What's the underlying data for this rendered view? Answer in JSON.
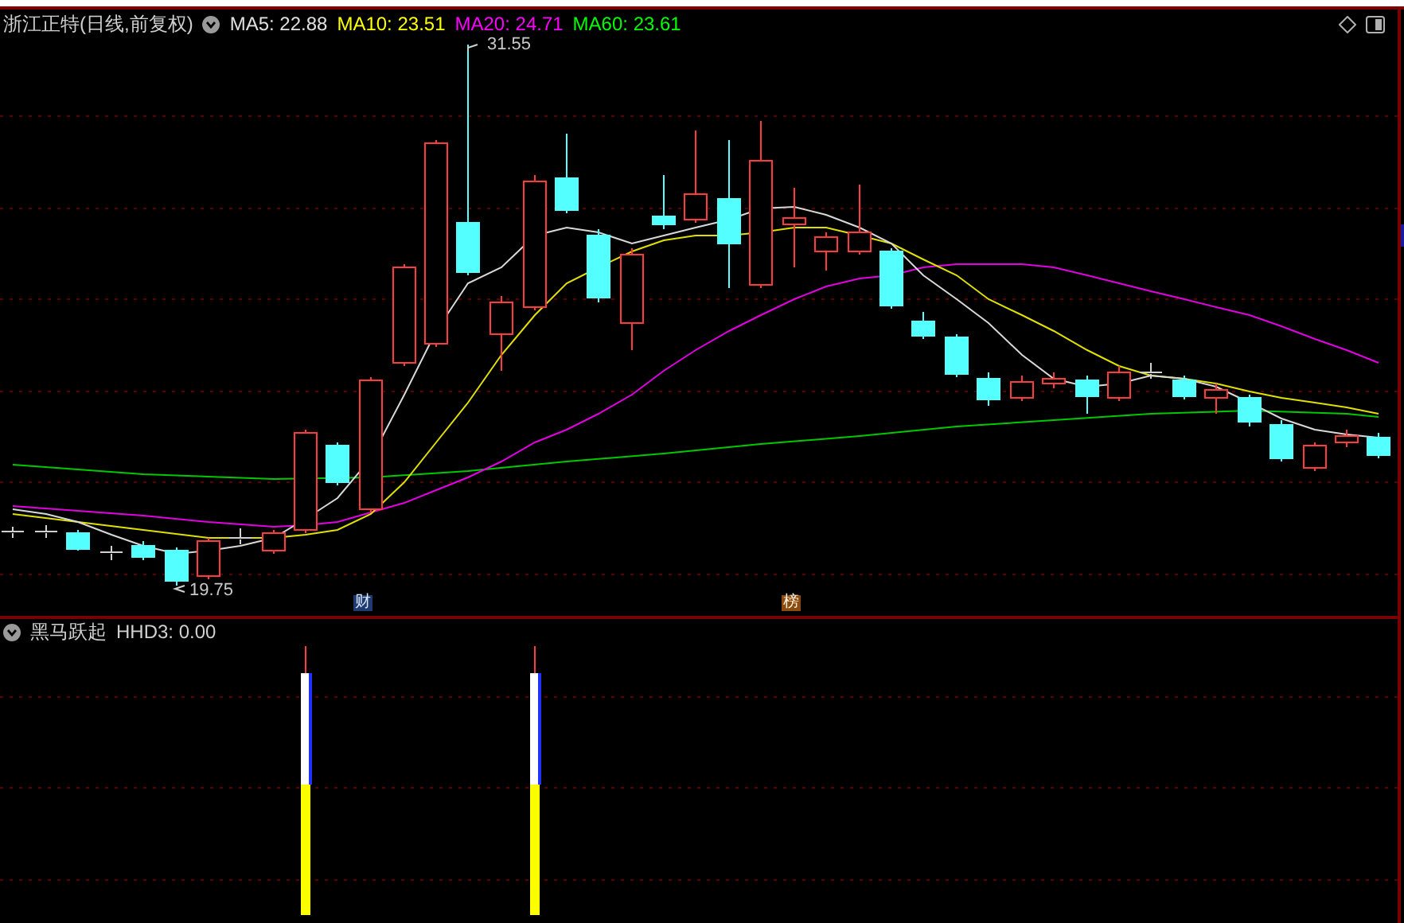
{
  "main_chart": {
    "title": "浙江正特(日线,前复权)",
    "legend": [
      {
        "label": "MA5: 22.88",
        "color": "#e0e0e0"
      },
      {
        "label": "MA10: 23.51",
        "color": "#ffff00"
      },
      {
        "label": "MA20: 24.71",
        "color": "#ff00ff"
      },
      {
        "label": "MA60: 23.61",
        "color": "#00ff00"
      }
    ],
    "high_label": "31.55",
    "low_label": "19.75",
    "markers": [
      {
        "label": "财",
        "kind": "finance"
      },
      {
        "label": "榜",
        "kind": "ranking"
      }
    ]
  },
  "indicator": {
    "title": "黑马跃起",
    "value": "HHD3: 0.00"
  }
}
